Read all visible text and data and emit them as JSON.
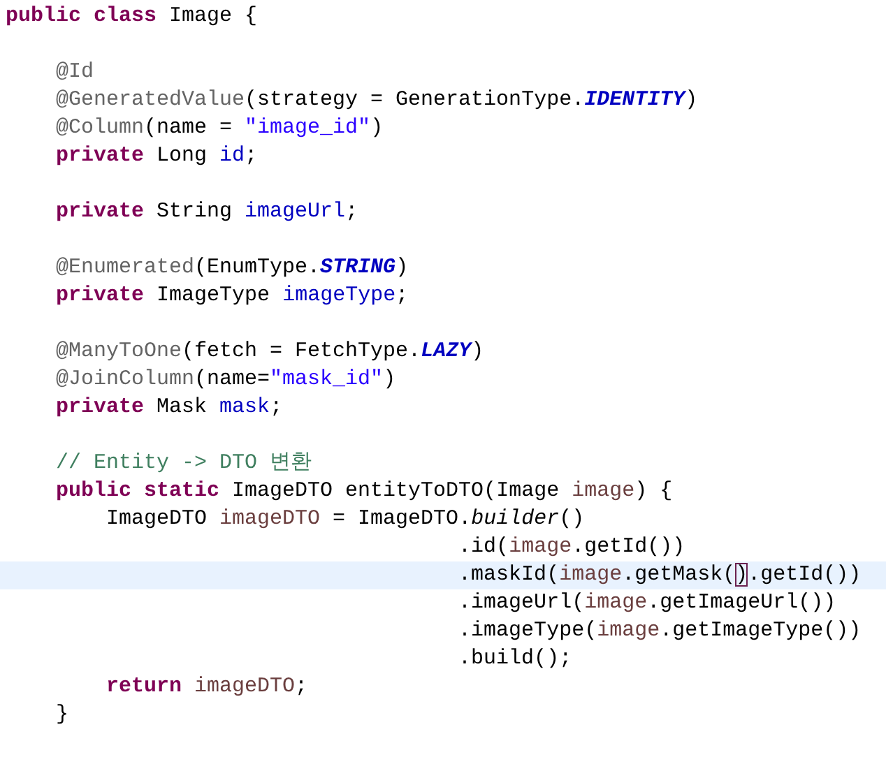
{
  "editor": {
    "lines": [
      {
        "current": false,
        "tokens": [
          {
            "kind": "keyword",
            "text": "public class"
          },
          {
            "kind": "plain",
            "text": " Image {"
          }
        ]
      },
      {
        "current": false
      },
      {
        "current": false,
        "tokens": [
          {
            "kind": "annotation",
            "text": "    @Id"
          }
        ]
      },
      {
        "current": false,
        "tokens": [
          {
            "kind": "annotation",
            "text": "    @GeneratedValue"
          },
          {
            "kind": "plain",
            "text": "(strategy = GenerationType."
          },
          {
            "kind": "constant",
            "text": "IDENTITY"
          },
          {
            "kind": "plain",
            "text": ")"
          }
        ]
      },
      {
        "current": false,
        "tokens": [
          {
            "kind": "annotation",
            "text": "    @Column"
          },
          {
            "kind": "plain",
            "text": "(name = "
          },
          {
            "kind": "string",
            "text": "\"image_id\""
          },
          {
            "kind": "plain",
            "text": ")"
          }
        ]
      },
      {
        "current": false,
        "tokens": [
          {
            "kind": "keyword",
            "text": "    private"
          },
          {
            "kind": "plain",
            "text": " Long "
          },
          {
            "kind": "field",
            "text": "id"
          },
          {
            "kind": "plain",
            "text": ";"
          }
        ]
      },
      {
        "current": false
      },
      {
        "current": false,
        "tokens": [
          {
            "kind": "keyword",
            "text": "    private"
          },
          {
            "kind": "plain",
            "text": " String "
          },
          {
            "kind": "field",
            "text": "imageUrl"
          },
          {
            "kind": "plain",
            "text": ";"
          }
        ]
      },
      {
        "current": false
      },
      {
        "current": false,
        "tokens": [
          {
            "kind": "annotation",
            "text": "    @Enumerated"
          },
          {
            "kind": "plain",
            "text": "(EnumType."
          },
          {
            "kind": "constant",
            "text": "STRING"
          },
          {
            "kind": "plain",
            "text": ")"
          }
        ]
      },
      {
        "current": false,
        "tokens": [
          {
            "kind": "keyword",
            "text": "    private"
          },
          {
            "kind": "plain",
            "text": " ImageType "
          },
          {
            "kind": "field",
            "text": "imageType"
          },
          {
            "kind": "plain",
            "text": ";"
          }
        ]
      },
      {
        "current": false
      },
      {
        "current": false,
        "tokens": [
          {
            "kind": "annotation",
            "text": "    @ManyToOne"
          },
          {
            "kind": "plain",
            "text": "(fetch = FetchType."
          },
          {
            "kind": "constant",
            "text": "LAZY"
          },
          {
            "kind": "plain",
            "text": ")"
          }
        ]
      },
      {
        "current": false,
        "tokens": [
          {
            "kind": "annotation",
            "text": "    @JoinColumn"
          },
          {
            "kind": "plain",
            "text": "(name="
          },
          {
            "kind": "string",
            "text": "\"mask_id\""
          },
          {
            "kind": "plain",
            "text": ")"
          }
        ]
      },
      {
        "current": false,
        "tokens": [
          {
            "kind": "keyword",
            "text": "    private"
          },
          {
            "kind": "plain",
            "text": " Mask "
          },
          {
            "kind": "field",
            "text": "mask"
          },
          {
            "kind": "plain",
            "text": ";"
          }
        ]
      },
      {
        "current": false
      },
      {
        "current": false,
        "tokens": [
          {
            "kind": "comment",
            "text": "    // Entity -> DTO 변환"
          }
        ]
      },
      {
        "current": false,
        "tokens": [
          {
            "kind": "keyword",
            "text": "    public static"
          },
          {
            "kind": "plain",
            "text": " ImageDTO entityToDTO(Image "
          },
          {
            "kind": "local",
            "text": "image"
          },
          {
            "kind": "plain",
            "text": ") {"
          }
        ]
      },
      {
        "current": false,
        "tokens": [
          {
            "kind": "plain",
            "text": "        ImageDTO "
          },
          {
            "kind": "local",
            "text": "imageDTO"
          },
          {
            "kind": "plain",
            "text": " = ImageDTO."
          },
          {
            "kind": "static",
            "text": "builder"
          },
          {
            "kind": "plain",
            "text": "()"
          }
        ]
      },
      {
        "current": false,
        "tokens": [
          {
            "kind": "plain",
            "text": "                                    .id("
          },
          {
            "kind": "local",
            "text": "image"
          },
          {
            "kind": "plain",
            "text": ".getId())"
          }
        ]
      },
      {
        "current": true,
        "tokens": [
          {
            "kind": "plain",
            "text": "                                    .maskId("
          },
          {
            "kind": "local",
            "text": "image"
          },
          {
            "kind": "plain",
            "text": ".getMask("
          },
          {
            "kind": "match",
            "text": ")"
          },
          {
            "kind": "plain",
            "text": ".getId())"
          }
        ]
      },
      {
        "current": false,
        "tokens": [
          {
            "kind": "plain",
            "text": "                                    .imageUrl("
          },
          {
            "kind": "local",
            "text": "image"
          },
          {
            "kind": "plain",
            "text": ".getImageUrl())"
          }
        ]
      },
      {
        "current": false,
        "tokens": [
          {
            "kind": "plain",
            "text": "                                    .imageType("
          },
          {
            "kind": "local",
            "text": "image"
          },
          {
            "kind": "plain",
            "text": ".getImageType())"
          }
        ]
      },
      {
        "current": false,
        "tokens": [
          {
            "kind": "plain",
            "text": "                                    .build();"
          }
        ]
      },
      {
        "current": false,
        "tokens": [
          {
            "kind": "keyword",
            "text": "        return"
          },
          {
            "kind": "local",
            "text": " imageDTO"
          },
          {
            "kind": "plain",
            "text": ";"
          }
        ]
      },
      {
        "current": false,
        "tokens": [
          {
            "kind": "plain",
            "text": "    }"
          }
        ]
      }
    ]
  }
}
